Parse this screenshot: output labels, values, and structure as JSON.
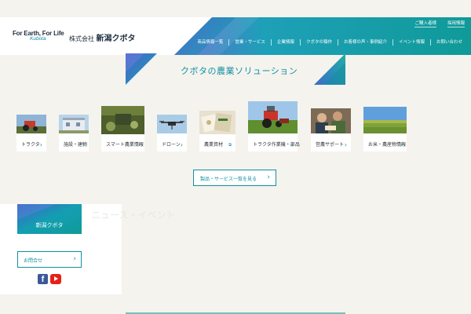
{
  "header": {
    "logo_line1": "For Earth, For Life",
    "logo_line2": "Kubota",
    "company_prefix": "株式会社",
    "company_name": "新潟クボタ",
    "util_links": [
      "ご購入者様",
      "採用情報"
    ],
    "nav_items": [
      "商品情報一覧",
      "営業・サービス",
      "企業情報",
      "クボタの稲作",
      "お客様の声・事例紹介",
      "イベント情報",
      "お問い合わせ"
    ]
  },
  "section": {
    "title": "クボタの農業ソリューション"
  },
  "cards": [
    {
      "label": "トラクタ"
    },
    {
      "label": "施設・建物"
    },
    {
      "label": "スマート農業情報"
    },
    {
      "label": "ドローン"
    },
    {
      "label": "農業資材"
    },
    {
      "label": "トラクタ作業機・部品"
    },
    {
      "label": "営農サポート"
    },
    {
      "label": "お米・農産物情報"
    }
  ],
  "more_button": {
    "label": "製品・サービス一覧を見る"
  },
  "sidebar": {
    "banner_label": "新潟クボタ",
    "faded_text": "ニュース・イベント",
    "button_label": "お問合せ",
    "social": [
      "facebook-icon",
      "youtube-icon"
    ]
  },
  "colors": {
    "accent": "#1290a0",
    "teal_dark": "#0f9a98",
    "blue_deep": "#2f6fc0",
    "background": "#f4f3ee"
  }
}
